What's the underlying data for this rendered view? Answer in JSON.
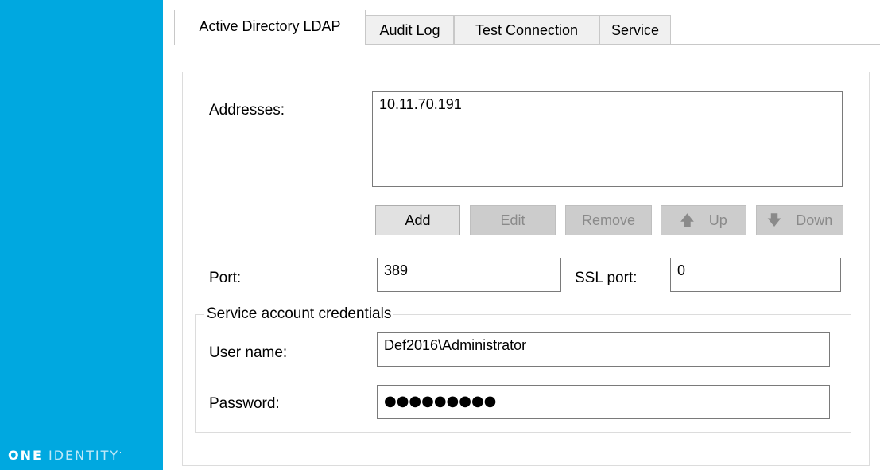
{
  "sidebar": {
    "logo_one": "ONE",
    "logo_identity": "IDENTITY",
    "logo_tm": "·"
  },
  "tabs": [
    {
      "label": "Active Directory LDAP",
      "active": true
    },
    {
      "label": "Audit Log",
      "active": false
    },
    {
      "label": "Test Connection",
      "active": false
    },
    {
      "label": "Service",
      "active": false
    }
  ],
  "ldap": {
    "addresses_label": "Addresses:",
    "addresses": [
      "10.11.70.191"
    ],
    "buttons": {
      "add": "Add",
      "edit": "Edit",
      "remove": "Remove",
      "up": "Up",
      "down": "Down"
    },
    "port_label": "Port:",
    "port_value": "389",
    "ssl_port_label": "SSL port:",
    "ssl_port_value": "0"
  },
  "credentials": {
    "group_title": "Service account credentials",
    "username_label": "User name:",
    "username_value": "Def2016\\Administrator",
    "password_label": "Password:",
    "password_mask": "●●●●●●●●●"
  }
}
